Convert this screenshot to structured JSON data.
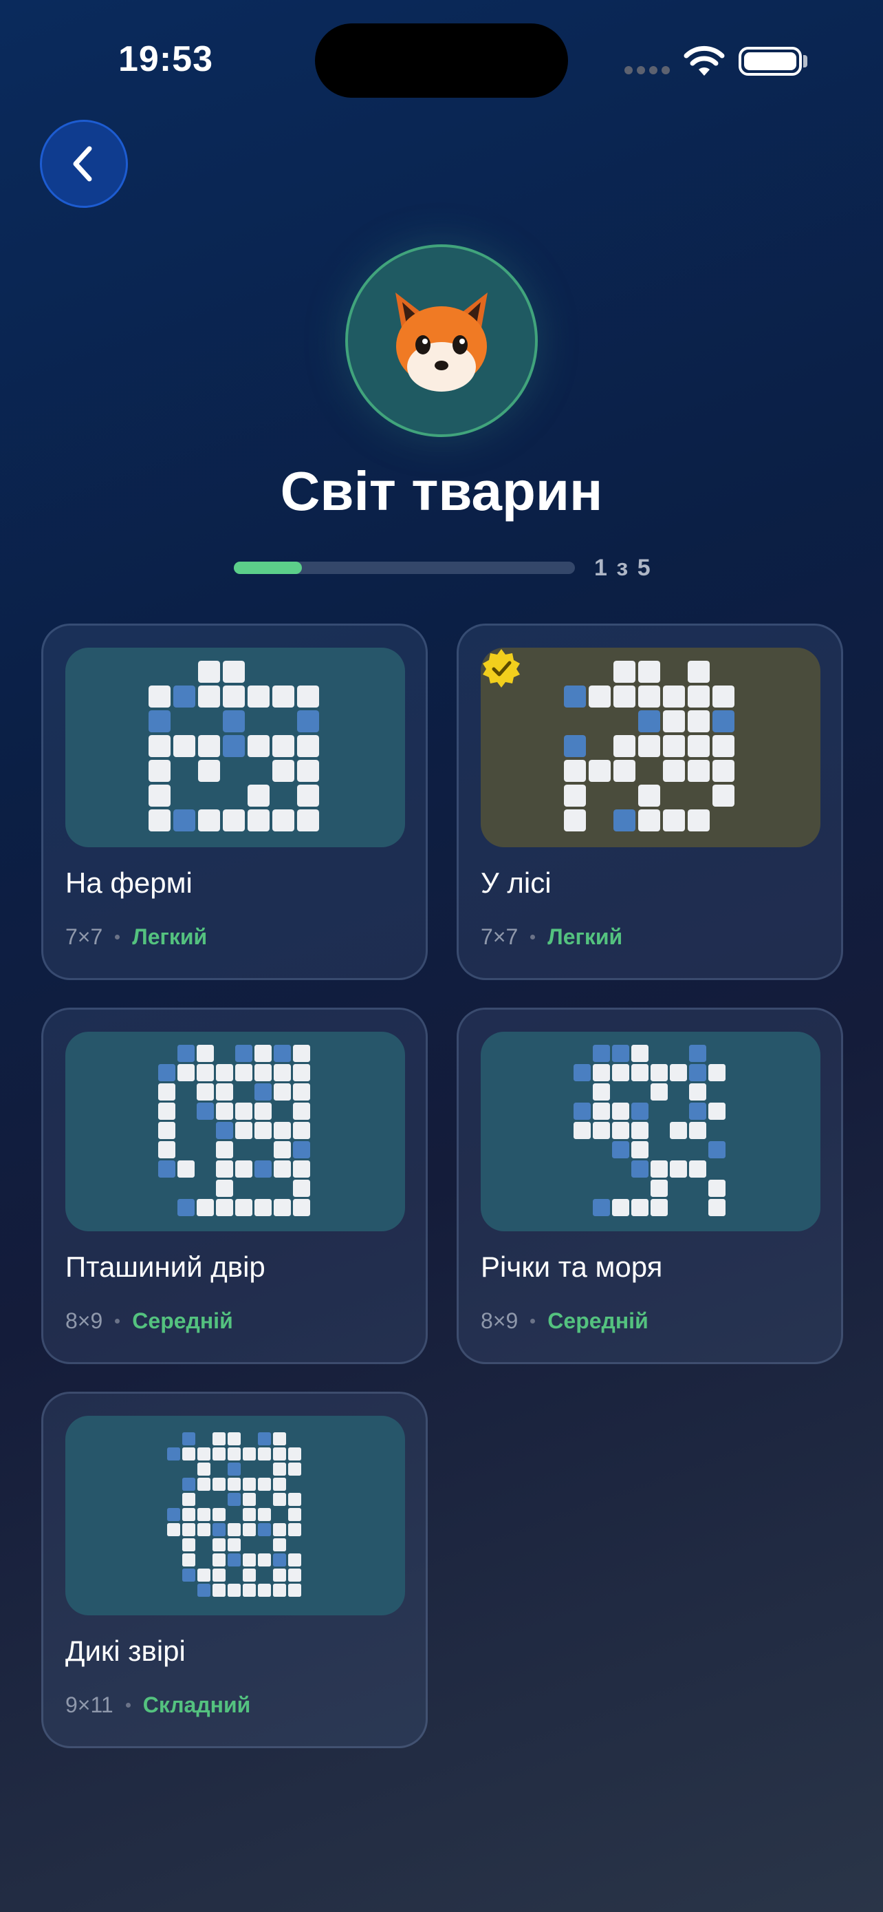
{
  "status": {
    "time": "19:53"
  },
  "category": {
    "emoji": "🦊",
    "title": "Світ тварин",
    "progress_text": "1 з 5",
    "progress_fraction": 0.2
  },
  "colors": {
    "accent": "#5ccf8a",
    "filled_cell": "#eef0f3",
    "hint_cell": "#4a7fc1"
  },
  "puzzles": [
    {
      "title": "На фермі",
      "size": "7×7",
      "difficulty": "Легкий",
      "completed": false,
      "grid": [
        "..##...",
        "1211111",
        "2..2..2",
        "1112111",
        "1.1..11",
        "1...1.1",
        "1211111"
      ]
    },
    {
      "title": "У лісі",
      "size": "7×7",
      "difficulty": "Легкий",
      "completed": true,
      "grid": [
        "..#1.1.",
        "2111111",
        "...2112",
        "2.11111",
        "111.111",
        "1..1..1",
        "1.2111."
      ]
    },
    {
      "title": "Пташиний двір",
      "size": "8×9",
      "difficulty": "Середній",
      "completed": false,
      "grid": [
        ".21.2121",
        "21111111",
        "1.11.211",
        "1.2111.1",
        "1..21111",
        "1..1..12",
        "21.11211",
        "...1...1",
        ".2111111"
      ]
    },
    {
      "title": "Річки та моря",
      "size": "8×9",
      "difficulty": "Середній",
      "completed": false,
      "grid": [
        ".221..2.",
        "21111121",
        ".1..1.1.",
        "2112..21",
        "1111.11.",
        "..21...2",
        "...2111.",
        "....1..1",
        ".2111..1"
      ]
    },
    {
      "title": "Дикі звірі",
      "size": "9×11",
      "difficulty": "Складний",
      "completed": false,
      "grid": [
        ".2.11.21.",
        "211111111",
        "..1.2..11",
        ".2111111.",
        ".1..21.11",
        "2111.11.1",
        "111211211",
        ".1.11..1.",
        ".1.121121",
        ".211.1.11",
        "..2111111"
      ]
    }
  ]
}
